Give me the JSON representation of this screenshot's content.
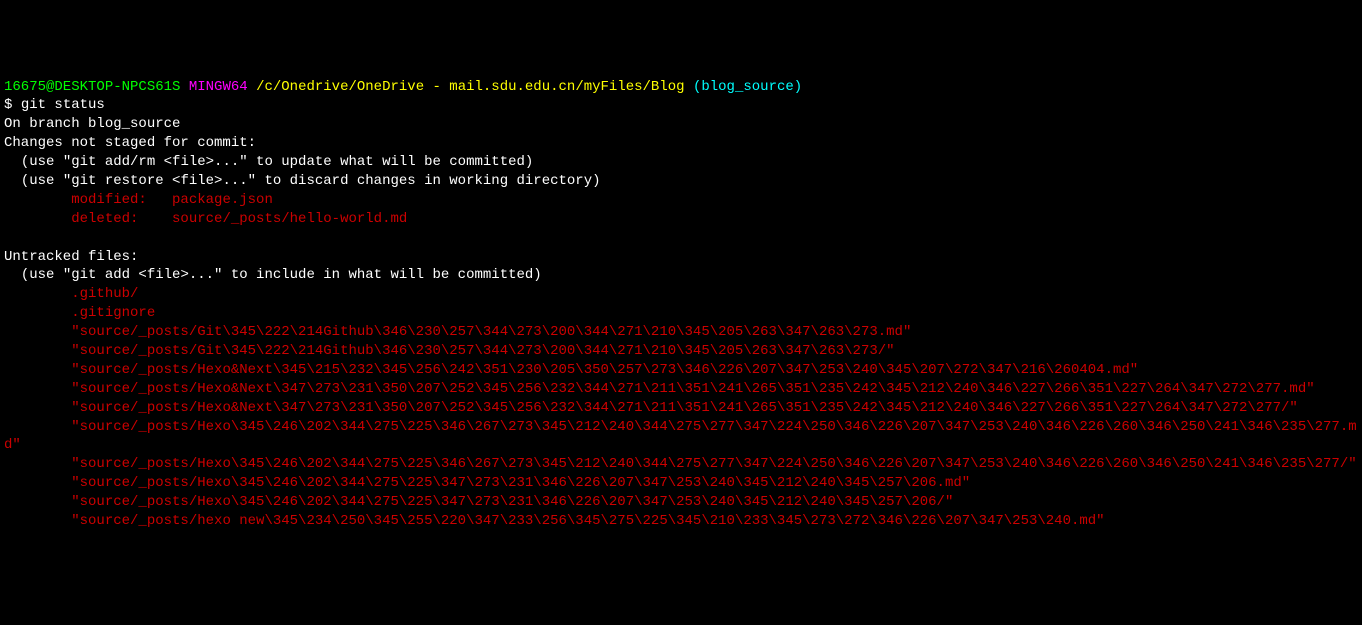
{
  "prompt": {
    "user": "16675@DESKTOP-NPCS61S",
    "system": "MINGW64",
    "path": "/c/Onedrive/OneDrive - mail.sdu.edu.cn/myFiles/Blog",
    "branch": "(blog_source)",
    "dollar": "$",
    "command": "git status"
  },
  "status": {
    "branch_line": "On branch blog_source",
    "changes_header": "Changes not staged for commit:",
    "hint1": "  (use \"git add/rm <file>...\" to update what will be committed)",
    "hint2": "  (use \"git restore <file>...\" to discard changes in working directory)",
    "modified1": "        modified:   package.json",
    "deleted1": "        deleted:    source/_posts/hello-world.md",
    "untracked_header": "Untracked files:",
    "untracked_hint": "  (use \"git add <file>...\" to include in what will be committed)",
    "u1": "        .github/",
    "u2": "        .gitignore",
    "u3": "        \"source/_posts/Git\\345\\222\\214Github\\346\\230\\257\\344\\273\\200\\344\\271\\210\\345\\205\\263\\347\\263\\273.md\"",
    "u4": "        \"source/_posts/Git\\345\\222\\214Github\\346\\230\\257\\344\\273\\200\\344\\271\\210\\345\\205\\263\\347\\263\\273/\"",
    "u5": "        \"source/_posts/Hexo&Next\\345\\215\\232\\345\\256\\242\\351\\230\\205\\350\\257\\273\\346\\226\\207\\347\\253\\240\\345\\207\\272\\347\\216\\260404.md\"",
    "u6": "        \"source/_posts/Hexo&Next\\347\\273\\231\\350\\207\\252\\345\\256\\232\\344\\271\\211\\351\\241\\265\\351\\235\\242\\345\\212\\240\\346\\227\\266\\351\\227\\264\\347\\272\\277.md\"",
    "u7": "        \"source/_posts/Hexo&Next\\347\\273\\231\\350\\207\\252\\345\\256\\232\\344\\271\\211\\351\\241\\265\\351\\235\\242\\345\\212\\240\\346\\227\\266\\351\\227\\264\\347\\272\\277/\"",
    "u8": "        \"source/_posts/Hexo\\345\\246\\202\\344\\275\\225\\346\\267\\273\\345\\212\\240\\344\\275\\277\\347\\224\\250\\346\\226\\207\\347\\253\\240\\346\\226\\260\\346\\250\\241\\346\\235\\277.md\"",
    "u9": "        \"source/_posts/Hexo\\345\\246\\202\\344\\275\\225\\346\\267\\273\\345\\212\\240\\344\\275\\277\\347\\224\\250\\346\\226\\207\\347\\253\\240\\346\\226\\260\\346\\250\\241\\346\\235\\277/\"",
    "u10": "        \"source/_posts/Hexo\\345\\246\\202\\344\\275\\225\\347\\273\\231\\346\\226\\207\\347\\253\\240\\345\\212\\240\\345\\257\\206.md\"",
    "u11": "        \"source/_posts/Hexo\\345\\246\\202\\344\\275\\225\\347\\273\\231\\346\\226\\207\\347\\253\\240\\345\\212\\240\\345\\257\\206/\"",
    "u12": "        \"source/_posts/hexo new\\345\\234\\250\\345\\255\\220\\347\\233\\256\\345\\275\\225\\345\\210\\233\\345\\273\\272\\346\\226\\207\\347\\253\\240.md\""
  }
}
